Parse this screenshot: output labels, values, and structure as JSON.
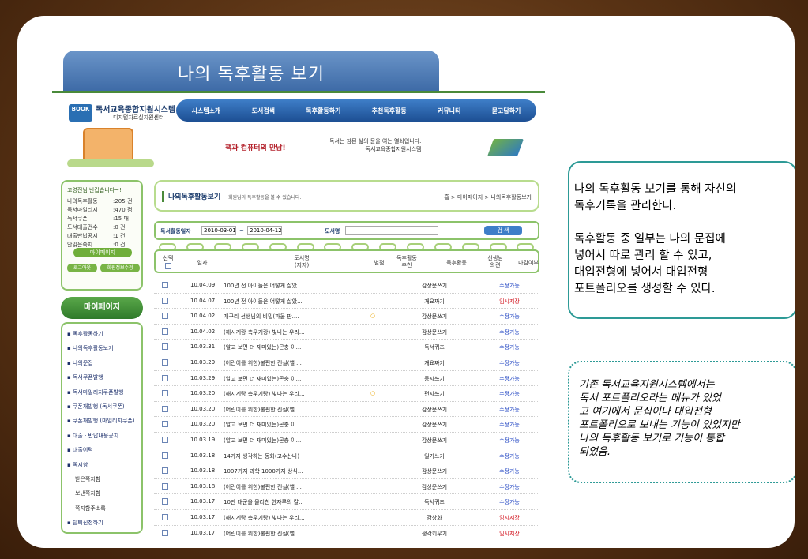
{
  "slide_title": "나의 독후활동 보기",
  "logo": {
    "badge": "BOOK",
    "name": "독서교육종합지원시스템",
    "sub": "디지털자료실지원센터"
  },
  "topnav": [
    "시스템소개",
    "도서검색",
    "독후활동하기",
    "추천독후활동",
    "커뮤니티",
    "묻고답하기"
  ],
  "banner": {
    "slogan1": "책과 컴퓨터의 만남!",
    "slogan2_line1": "독서는 참된 삶의 문을 여는 열쇠입니다.",
    "slogan2_line2": "독서교육종합지원시스템"
  },
  "login": {
    "welcome": "고영전님 반갑습니다~!",
    "stats": [
      {
        "label": "나의독후활동",
        "value": ":205 건"
      },
      {
        "label": "독서마일리지",
        "value": ":470 점"
      },
      {
        "label": "독서쿠폰",
        "value": ":15 매"
      },
      {
        "label": "도서대출건수",
        "value": ":0 건"
      },
      {
        "label": "대출반납공지",
        "value": ":1 건"
      },
      {
        "label": "안읽은쪽지",
        "value": ":0 건"
      }
    ],
    "mypage_button": "마이페이지",
    "logout_button": "로그아웃",
    "edit_button": "회원정보수정"
  },
  "menu": {
    "title": "마이페이지",
    "items": [
      {
        "label": "독후활동하기",
        "sub": false
      },
      {
        "label": "나의독후활동보기",
        "sub": false
      },
      {
        "label": "나의문집",
        "sub": false
      },
      {
        "label": "독서쿠폰발행",
        "sub": false
      },
      {
        "label": "독서마일리지쿠폰발행",
        "sub": false
      },
      {
        "label": "쿠폰재발행 (독서쿠폰)",
        "sub": false
      },
      {
        "label": "쿠폰재발행 (마일리지쿠폰)",
        "sub": false
      },
      {
        "label": "대출 · 반납내용공지",
        "sub": false
      },
      {
        "label": "대출이력",
        "sub": false
      },
      {
        "label": "쪽지함",
        "sub": false
      },
      {
        "label": "받은쪽지함",
        "sub": true
      },
      {
        "label": "보낸쪽지함",
        "sub": true
      },
      {
        "label": "쪽지함주소록",
        "sub": true
      },
      {
        "label": "탈퇴신청하기",
        "sub": false
      }
    ]
  },
  "content": {
    "title": "나의독후활동보기",
    "desc": "회원님의 독후활동을 볼 수 있습니다.",
    "breadcrumb": "홈 > 마이페이지 > 나의독후활동보기",
    "search": {
      "date_label": "독서활동일자",
      "from": "2010-03-01",
      "tilde": "~",
      "to": "2010-04-12",
      "book_label": "도서명",
      "book_value": "",
      "button": "검 색"
    },
    "columns": {
      "select": "선택",
      "date": "일자",
      "book_line1": "도서명",
      "book_line2": "(지자)",
      "grade": "별점",
      "rec_line1": "독후활동",
      "rec_line2": "추천",
      "type": "독후활동",
      "teacher_line1": "선생님",
      "teacher_line2": "의견",
      "status": "마감여부"
    },
    "rows": [
      {
        "date": "10.04.09",
        "title": "100년 전 아이들은 어떻게 살았...",
        "rec": "",
        "type": "감상문쓰기",
        "status": "수정가능",
        "status_color": "#1a3fc0"
      },
      {
        "date": "10.04.07",
        "title": "100년 전 아이들은 어떻게 살았...",
        "rec": "",
        "type": "개요짜기",
        "status": "임시저장",
        "status_color": "#d2141e"
      },
      {
        "date": "10.04.02",
        "title": "개구리 선생님의 비밀(파울 판....",
        "rec": "○",
        "type": "감상문쓰기",
        "status": "수정가능",
        "status_color": "#1a3fc0"
      },
      {
        "date": "10.04.02",
        "title": "(해시계랑 측우기랑) 빛나는 우리...",
        "rec": "",
        "type": "감상문쓰기",
        "status": "수정가능",
        "status_color": "#1a3fc0"
      },
      {
        "date": "10.03.31",
        "title": "(알고 보면 더 재미있는)곤충 이...",
        "rec": "",
        "type": "독서퀴즈",
        "status": "수정가능",
        "status_color": "#1a3fc0"
      },
      {
        "date": "10.03.29",
        "title": "(어린이를 위한)불편한 진실(앨 ...",
        "rec": "",
        "type": "개요짜기",
        "status": "수정가능",
        "status_color": "#1a3fc0"
      },
      {
        "date": "10.03.29",
        "title": "(알고 보면 더 재미있는)곤충 이...",
        "rec": "",
        "type": "동시쓰기",
        "status": "수정가능",
        "status_color": "#1a3fc0"
      },
      {
        "date": "10.03.20",
        "title": "(해시계랑 측우기랑) 빛나는 우리...",
        "rec": "○",
        "type": "편지쓰기",
        "status": "수정가능",
        "status_color": "#1a3fc0"
      },
      {
        "date": "10.03.20",
        "title": "(어린이를 위한)불편한 진실(앨 ...",
        "rec": "",
        "type": "감상문쓰기",
        "status": "수정가능",
        "status_color": "#1a3fc0"
      },
      {
        "date": "10.03.20",
        "title": "(알고 보면 더 재미있는)곤충 이...",
        "rec": "",
        "type": "감상문쓰기",
        "status": "수정가능",
        "status_color": "#1a3fc0"
      },
      {
        "date": "10.03.19",
        "title": "(알고 보면 더 재미있는)곤충 이...",
        "rec": "",
        "type": "감상문쓰기",
        "status": "수정가능",
        "status_color": "#1a3fc0"
      },
      {
        "date": "10.03.18",
        "title": "14가지 생각하는 동화(고수산나)",
        "rec": "",
        "type": "일기쓰기",
        "status": "수정가능",
        "status_color": "#1a3fc0"
      },
      {
        "date": "10.03.18",
        "title": "1007가지 과학 1000가지 상식...",
        "rec": "",
        "type": "감상문쓰기",
        "status": "수정가능",
        "status_color": "#1a3fc0"
      },
      {
        "date": "10.03.18",
        "title": "(어린이를 위한)불편한 진실(앨 ...",
        "rec": "",
        "type": "감상문쓰기",
        "status": "수정가능",
        "status_color": "#1a3fc0"
      },
      {
        "date": "10.03.17",
        "title": "10만 대군을 물리친 한자루의 칼...",
        "rec": "",
        "type": "독서퀴즈",
        "status": "수정가능",
        "status_color": "#1a3fc0"
      },
      {
        "date": "10.03.17",
        "title": "(해시계랑 측우기랑) 빛나는 우리...",
        "rec": "",
        "type": "감상화",
        "status": "임시저장",
        "status_color": "#d2141e"
      },
      {
        "date": "10.03.17",
        "title": "(어린이를 위한)불편한 진실(앨 ...",
        "rec": "",
        "type": "생각키우기",
        "status": "임시저장",
        "status_color": "#d2141e"
      }
    ]
  },
  "note1": "나의 독후활동 보기를 통해 자신의\n독후기록을  관리한다.\n\n독후활동 중 일부는 나의 문집에\n넣어서 따로 관리 할 수 있고,\n대입전형에 넣어서 대입전형\n포트폴리오를 생성할 수 있다.",
  "note2": "기존 독서교육지원시스템에서는\n독서 포트폴리오라는 메뉴가 있었\n고 여기에서 문집이나 대입전형\n포트폴리오로 보내는 기능이 있었지만\n나의 독후활동 보기로 기능이 통합\n되었음."
}
